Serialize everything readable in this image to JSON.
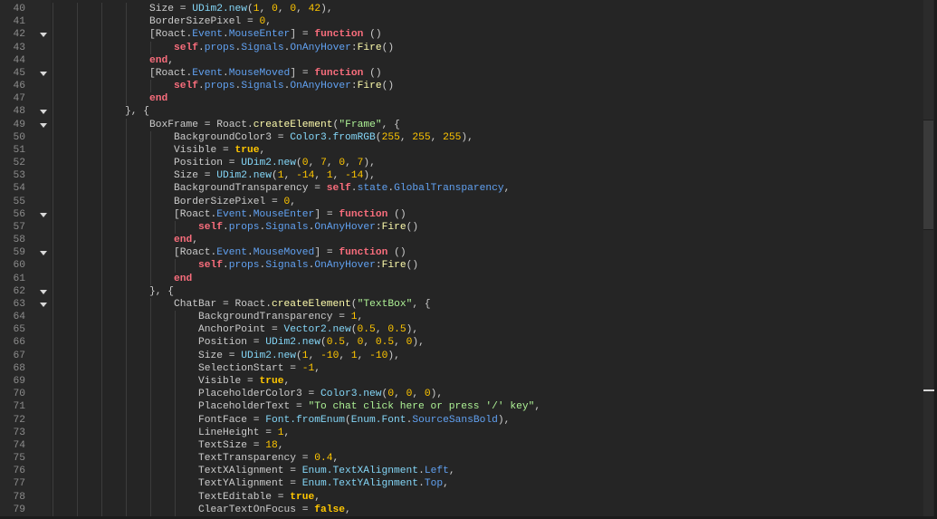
{
  "editor": {
    "lines": [
      {
        "n": "40",
        "indent": 16,
        "fold": false,
        "tokens": [
          [
            "p",
            "Size = "
          ],
          [
            "b",
            "UDim2.new"
          ],
          [
            "p",
            "("
          ],
          [
            "n",
            "1"
          ],
          [
            "p",
            ", "
          ],
          [
            "n",
            "0"
          ],
          [
            "p",
            ", "
          ],
          [
            "n",
            "0"
          ],
          [
            "p",
            ", "
          ],
          [
            "n",
            "42"
          ],
          [
            "p",
            "),"
          ]
        ]
      },
      {
        "n": "41",
        "indent": 16,
        "fold": false,
        "tokens": [
          [
            "p",
            "BorderSizePixel = "
          ],
          [
            "n",
            "0"
          ],
          [
            "p",
            ","
          ]
        ]
      },
      {
        "n": "42",
        "indent": 16,
        "fold": true,
        "tokens": [
          [
            "p",
            "[Roact."
          ],
          [
            "m",
            "Event"
          ],
          [
            "p",
            "."
          ],
          [
            "m",
            "MouseEnter"
          ],
          [
            "p",
            "] = "
          ],
          [
            "k",
            "function"
          ],
          [
            "p",
            " ()"
          ]
        ]
      },
      {
        "n": "43",
        "indent": 20,
        "fold": false,
        "tokens": [
          [
            "k",
            "self"
          ],
          [
            "p",
            "."
          ],
          [
            "m",
            "props"
          ],
          [
            "p",
            "."
          ],
          [
            "m",
            "Signals"
          ],
          [
            "p",
            "."
          ],
          [
            "m",
            "OnAnyHover"
          ],
          [
            "p",
            ":"
          ],
          [
            "f",
            "Fire"
          ],
          [
            "p",
            "()"
          ]
        ]
      },
      {
        "n": "44",
        "indent": 16,
        "fold": false,
        "tokens": [
          [
            "k",
            "end"
          ],
          [
            "p",
            ","
          ]
        ]
      },
      {
        "n": "45",
        "indent": 16,
        "fold": true,
        "tokens": [
          [
            "p",
            "[Roact."
          ],
          [
            "m",
            "Event"
          ],
          [
            "p",
            "."
          ],
          [
            "m",
            "MouseMoved"
          ],
          [
            "p",
            "] = "
          ],
          [
            "k",
            "function"
          ],
          [
            "p",
            " ()"
          ]
        ]
      },
      {
        "n": "46",
        "indent": 20,
        "fold": false,
        "tokens": [
          [
            "k",
            "self"
          ],
          [
            "p",
            "."
          ],
          [
            "m",
            "props"
          ],
          [
            "p",
            "."
          ],
          [
            "m",
            "Signals"
          ],
          [
            "p",
            "."
          ],
          [
            "m",
            "OnAnyHover"
          ],
          [
            "p",
            ":"
          ],
          [
            "f",
            "Fire"
          ],
          [
            "p",
            "()"
          ]
        ]
      },
      {
        "n": "47",
        "indent": 16,
        "fold": false,
        "tokens": [
          [
            "k",
            "end"
          ]
        ]
      },
      {
        "n": "48",
        "indent": 12,
        "fold": true,
        "tokens": [
          [
            "p",
            "}, {"
          ]
        ]
      },
      {
        "n": "49",
        "indent": 16,
        "fold": true,
        "tokens": [
          [
            "p",
            "BoxFrame = Roact."
          ],
          [
            "f",
            "createElement"
          ],
          [
            "p",
            "("
          ],
          [
            "s",
            "\"Frame\""
          ],
          [
            "p",
            ", {"
          ]
        ]
      },
      {
        "n": "50",
        "indent": 20,
        "fold": false,
        "tokens": [
          [
            "p",
            "BackgroundColor3 = "
          ],
          [
            "b",
            "Color3.fromRGB"
          ],
          [
            "p",
            "("
          ],
          [
            "n",
            "255"
          ],
          [
            "p",
            ", "
          ],
          [
            "n",
            "255"
          ],
          [
            "p",
            ", "
          ],
          [
            "n",
            "255"
          ],
          [
            "p",
            "),"
          ]
        ]
      },
      {
        "n": "51",
        "indent": 20,
        "fold": false,
        "tokens": [
          [
            "p",
            "Visible = "
          ],
          [
            "c",
            "true"
          ],
          [
            "p",
            ","
          ]
        ]
      },
      {
        "n": "52",
        "indent": 20,
        "fold": false,
        "tokens": [
          [
            "p",
            "Position = "
          ],
          [
            "b",
            "UDim2.new"
          ],
          [
            "p",
            "("
          ],
          [
            "n",
            "0"
          ],
          [
            "p",
            ", "
          ],
          [
            "n",
            "7"
          ],
          [
            "p",
            ", "
          ],
          [
            "n",
            "0"
          ],
          [
            "p",
            ", "
          ],
          [
            "n",
            "7"
          ],
          [
            "p",
            "),"
          ]
        ]
      },
      {
        "n": "53",
        "indent": 20,
        "fold": false,
        "tokens": [
          [
            "p",
            "Size = "
          ],
          [
            "b",
            "UDim2.new"
          ],
          [
            "p",
            "("
          ],
          [
            "n",
            "1"
          ],
          [
            "p",
            ", "
          ],
          [
            "n",
            "-14"
          ],
          [
            "p",
            ", "
          ],
          [
            "n",
            "1"
          ],
          [
            "p",
            ", "
          ],
          [
            "n",
            "-14"
          ],
          [
            "p",
            "),"
          ]
        ]
      },
      {
        "n": "54",
        "indent": 20,
        "fold": false,
        "tokens": [
          [
            "p",
            "BackgroundTransparency = "
          ],
          [
            "k",
            "self"
          ],
          [
            "p",
            "."
          ],
          [
            "m",
            "state"
          ],
          [
            "p",
            "."
          ],
          [
            "m",
            "GlobalTransparency"
          ],
          [
            "p",
            ","
          ]
        ]
      },
      {
        "n": "55",
        "indent": 20,
        "fold": false,
        "tokens": [
          [
            "p",
            "BorderSizePixel = "
          ],
          [
            "n",
            "0"
          ],
          [
            "p",
            ","
          ]
        ]
      },
      {
        "n": "56",
        "indent": 20,
        "fold": true,
        "tokens": [
          [
            "p",
            "[Roact."
          ],
          [
            "m",
            "Event"
          ],
          [
            "p",
            "."
          ],
          [
            "m",
            "MouseEnter"
          ],
          [
            "p",
            "] = "
          ],
          [
            "k",
            "function"
          ],
          [
            "p",
            " ()"
          ]
        ]
      },
      {
        "n": "57",
        "indent": 24,
        "fold": false,
        "tokens": [
          [
            "k",
            "self"
          ],
          [
            "p",
            "."
          ],
          [
            "m",
            "props"
          ],
          [
            "p",
            "."
          ],
          [
            "m",
            "Signals"
          ],
          [
            "p",
            "."
          ],
          [
            "m",
            "OnAnyHover"
          ],
          [
            "p",
            ":"
          ],
          [
            "f",
            "Fire"
          ],
          [
            "p",
            "()"
          ]
        ]
      },
      {
        "n": "58",
        "indent": 20,
        "fold": false,
        "tokens": [
          [
            "k",
            "end"
          ],
          [
            "p",
            ","
          ]
        ]
      },
      {
        "n": "59",
        "indent": 20,
        "fold": true,
        "tokens": [
          [
            "p",
            "[Roact."
          ],
          [
            "m",
            "Event"
          ],
          [
            "p",
            "."
          ],
          [
            "m",
            "MouseMoved"
          ],
          [
            "p",
            "] = "
          ],
          [
            "k",
            "function"
          ],
          [
            "p",
            " ()"
          ]
        ]
      },
      {
        "n": "60",
        "indent": 24,
        "fold": false,
        "tokens": [
          [
            "k",
            "self"
          ],
          [
            "p",
            "."
          ],
          [
            "m",
            "props"
          ],
          [
            "p",
            "."
          ],
          [
            "m",
            "Signals"
          ],
          [
            "p",
            "."
          ],
          [
            "m",
            "OnAnyHover"
          ],
          [
            "p",
            ":"
          ],
          [
            "f",
            "Fire"
          ],
          [
            "p",
            "()"
          ]
        ]
      },
      {
        "n": "61",
        "indent": 20,
        "fold": false,
        "tokens": [
          [
            "k",
            "end"
          ]
        ]
      },
      {
        "n": "62",
        "indent": 16,
        "fold": true,
        "tokens": [
          [
            "p",
            "}, {"
          ]
        ]
      },
      {
        "n": "63",
        "indent": 20,
        "fold": true,
        "tokens": [
          [
            "p",
            "ChatBar = Roact."
          ],
          [
            "f",
            "createElement"
          ],
          [
            "p",
            "("
          ],
          [
            "s",
            "\"TextBox\""
          ],
          [
            "p",
            ", {"
          ]
        ]
      },
      {
        "n": "64",
        "indent": 24,
        "fold": false,
        "tokens": [
          [
            "p",
            "BackgroundTransparency = "
          ],
          [
            "n",
            "1"
          ],
          [
            "p",
            ","
          ]
        ]
      },
      {
        "n": "65",
        "indent": 24,
        "fold": false,
        "tokens": [
          [
            "p",
            "AnchorPoint = "
          ],
          [
            "b",
            "Vector2.new"
          ],
          [
            "p",
            "("
          ],
          [
            "n",
            "0.5"
          ],
          [
            "p",
            ", "
          ],
          [
            "n",
            "0.5"
          ],
          [
            "p",
            "),"
          ]
        ]
      },
      {
        "n": "66",
        "indent": 24,
        "fold": false,
        "tokens": [
          [
            "p",
            "Position = "
          ],
          [
            "b",
            "UDim2.new"
          ],
          [
            "p",
            "("
          ],
          [
            "n",
            "0.5"
          ],
          [
            "p",
            ", "
          ],
          [
            "n",
            "0"
          ],
          [
            "p",
            ", "
          ],
          [
            "n",
            "0.5"
          ],
          [
            "p",
            ", "
          ],
          [
            "n",
            "0"
          ],
          [
            "p",
            "),"
          ]
        ]
      },
      {
        "n": "67",
        "indent": 24,
        "fold": false,
        "tokens": [
          [
            "p",
            "Size = "
          ],
          [
            "b",
            "UDim2.new"
          ],
          [
            "p",
            "("
          ],
          [
            "n",
            "1"
          ],
          [
            "p",
            ", "
          ],
          [
            "n",
            "-10"
          ],
          [
            "p",
            ", "
          ],
          [
            "n",
            "1"
          ],
          [
            "p",
            ", "
          ],
          [
            "n",
            "-10"
          ],
          [
            "p",
            "),"
          ]
        ]
      },
      {
        "n": "68",
        "indent": 24,
        "fold": false,
        "tokens": [
          [
            "p",
            "SelectionStart = "
          ],
          [
            "n",
            "-1"
          ],
          [
            "p",
            ","
          ]
        ]
      },
      {
        "n": "69",
        "indent": 24,
        "fold": false,
        "tokens": [
          [
            "p",
            "Visible = "
          ],
          [
            "c",
            "true"
          ],
          [
            "p",
            ","
          ]
        ]
      },
      {
        "n": "70",
        "indent": 24,
        "fold": false,
        "tokens": [
          [
            "p",
            "PlaceholderColor3 = "
          ],
          [
            "b",
            "Color3.new"
          ],
          [
            "p",
            "("
          ],
          [
            "n",
            "0"
          ],
          [
            "p",
            ", "
          ],
          [
            "n",
            "0"
          ],
          [
            "p",
            ", "
          ],
          [
            "n",
            "0"
          ],
          [
            "p",
            "),"
          ]
        ]
      },
      {
        "n": "71",
        "indent": 24,
        "fold": false,
        "tokens": [
          [
            "p",
            "PlaceholderText = "
          ],
          [
            "s",
            "\"To chat click here or press '/' key\""
          ],
          [
            "p",
            ","
          ]
        ]
      },
      {
        "n": "72",
        "indent": 24,
        "fold": false,
        "tokens": [
          [
            "p",
            "FontFace = "
          ],
          [
            "b",
            "Font.fromEnum"
          ],
          [
            "p",
            "("
          ],
          [
            "b",
            "Enum.Font"
          ],
          [
            "p",
            "."
          ],
          [
            "m",
            "SourceSansBold"
          ],
          [
            "p",
            "),"
          ]
        ]
      },
      {
        "n": "73",
        "indent": 24,
        "fold": false,
        "tokens": [
          [
            "p",
            "LineHeight = "
          ],
          [
            "n",
            "1"
          ],
          [
            "p",
            ","
          ]
        ]
      },
      {
        "n": "74",
        "indent": 24,
        "fold": false,
        "tokens": [
          [
            "p",
            "TextSize = "
          ],
          [
            "n",
            "18"
          ],
          [
            "p",
            ","
          ]
        ]
      },
      {
        "n": "75",
        "indent": 24,
        "fold": false,
        "tokens": [
          [
            "p",
            "TextTransparency = "
          ],
          [
            "n",
            "0.4"
          ],
          [
            "p",
            ","
          ]
        ]
      },
      {
        "n": "76",
        "indent": 24,
        "fold": false,
        "tokens": [
          [
            "p",
            "TextXAlignment = "
          ],
          [
            "b",
            "Enum.TextXAlignment"
          ],
          [
            "p",
            "."
          ],
          [
            "m",
            "Left"
          ],
          [
            "p",
            ","
          ]
        ]
      },
      {
        "n": "77",
        "indent": 24,
        "fold": false,
        "tokens": [
          [
            "p",
            "TextYAlignment = "
          ],
          [
            "b",
            "Enum.TextYAlignment"
          ],
          [
            "p",
            "."
          ],
          [
            "m",
            "Top"
          ],
          [
            "p",
            ","
          ]
        ]
      },
      {
        "n": "78",
        "indent": 24,
        "fold": false,
        "tokens": [
          [
            "p",
            "TextEditable = "
          ],
          [
            "c",
            "true"
          ],
          [
            "p",
            ","
          ]
        ]
      },
      {
        "n": "79",
        "indent": 24,
        "fold": false,
        "tokens": [
          [
            "p",
            "ClearTextOnFocus = "
          ],
          [
            "c",
            "false"
          ],
          [
            "p",
            ","
          ]
        ]
      }
    ]
  },
  "scrollbar": {
    "thumb_start_fraction": 0.23,
    "thumb_size_fraction": 0.21
  }
}
